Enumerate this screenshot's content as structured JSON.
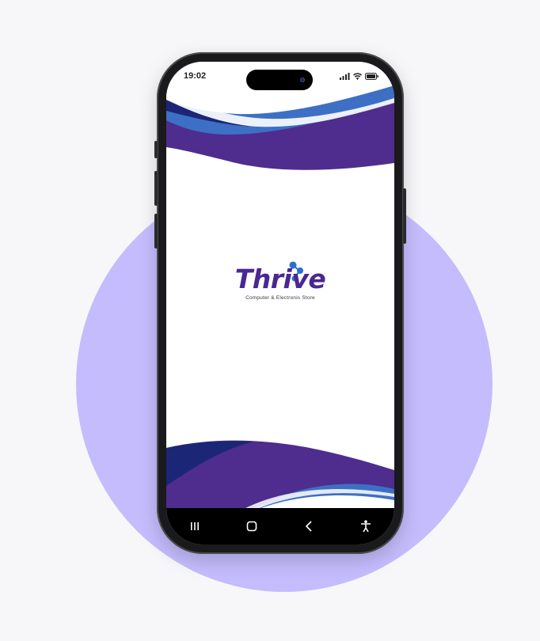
{
  "status_bar": {
    "time": "19:02"
  },
  "app": {
    "brand": "Thrive",
    "tagline": "Computer & Electronis Store"
  },
  "colors": {
    "background": "#f7f7f9",
    "circle": "#c5bcfd",
    "brand_purple": "#4a2792",
    "wave_purple": "#4e2d8e",
    "wave_blue": "#3d70c4",
    "wave_navy": "#1c2676"
  },
  "icons": {
    "signal": "cellular-signal-icon",
    "wifi": "wifi-icon",
    "battery": "battery-icon",
    "molecule": "molecule-icon",
    "recents": "recent-apps-icon",
    "home": "home-icon",
    "back": "back-icon",
    "accessibility": "accessibility-icon"
  }
}
